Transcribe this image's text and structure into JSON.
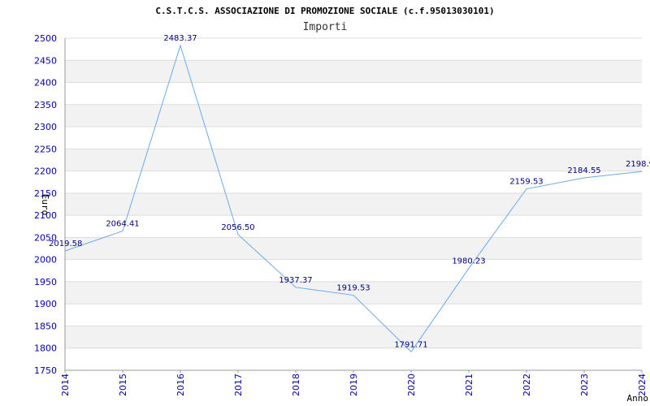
{
  "chart_data": {
    "type": "line",
    "title": "C.S.T.C.S. ASSOCIAZIONE DI PROMOZIONE SOCIALE (c.f.95013030101)",
    "subtitle": "Importi",
    "xlabel": "Anno",
    "ylabel": "Euro",
    "x": [
      2014,
      2015,
      2016,
      2017,
      2018,
      2019,
      2020,
      2021,
      2022,
      2023,
      2024
    ],
    "series": [
      {
        "values": [
          2019.58,
          2064.41,
          2483.37,
          2056.5,
          1937.37,
          1919.53,
          1791.71,
          1980.23,
          2159.53,
          2184.55,
          2198.9
        ],
        "labels": [
          "2019.58",
          "2064.41",
          "2483.37",
          "2056.50",
          "1937.37",
          "1919.53",
          "1791.71",
          "1980.23",
          "2159.53",
          "2184.55",
          "2198.9"
        ]
      }
    ],
    "ylim": [
      1750,
      2500
    ],
    "yticks": [
      1750,
      1800,
      1850,
      1900,
      1950,
      2000,
      2050,
      2100,
      2150,
      2200,
      2250,
      2300,
      2350,
      2400,
      2450,
      2500
    ],
    "grid": true,
    "colors": {
      "line": "#6aaae8",
      "band": "#f2f2f2",
      "gridline": "#dddddd",
      "tick_text": "#0000aa",
      "label_text": "#000080"
    }
  }
}
